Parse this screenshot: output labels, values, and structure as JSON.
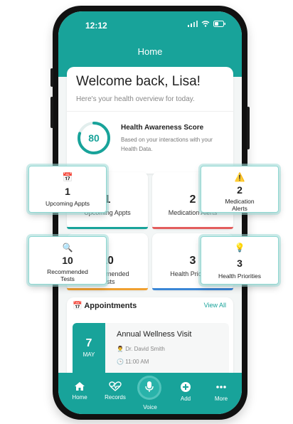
{
  "status": {
    "time": "12:12"
  },
  "header": {
    "title": "Home"
  },
  "welcome": {
    "title": "Welcome back, Lisa!",
    "subtitle": "Here's your health overview for today."
  },
  "score": {
    "value": "80",
    "fraction": 0.8,
    "title": "Health Awareness Score",
    "description": "Based on your interactions with your Health Data."
  },
  "tiles": [
    {
      "value": "1",
      "label": "Upcoming Appts",
      "icon": "calendar-icon",
      "accent": "#18a39a"
    },
    {
      "value": "2",
      "label": "Medication Alerts",
      "icon": "warning-icon",
      "accent": "#e35d5d"
    },
    {
      "value": "10",
      "label": "Recommended Tests",
      "icon": "magnifier-icon",
      "accent": "#f0a030"
    },
    {
      "value": "3",
      "label": "Health Priorities",
      "icon": "lightbulb-icon",
      "accent": "#3a86d6"
    }
  ],
  "appointments": {
    "title": "Appointments",
    "view_all": "View All",
    "items": [
      {
        "day": "7",
        "month": "MAY",
        "title": "Annual Wellness Visit",
        "doctor": "Dr. David Smith",
        "time": "11:00 AM"
      }
    ]
  },
  "tabs": [
    {
      "label": "Home",
      "icon": "home-icon"
    },
    {
      "label": "Records",
      "icon": "heartbeat-icon"
    },
    {
      "label": "Voice",
      "icon": "microphone-icon"
    },
    {
      "label": "Add",
      "icon": "plus-circle-icon"
    },
    {
      "label": "More",
      "icon": "more-dots-icon"
    }
  ],
  "colors": {
    "primary": "#18a39a",
    "background": "#f3f6f6"
  }
}
